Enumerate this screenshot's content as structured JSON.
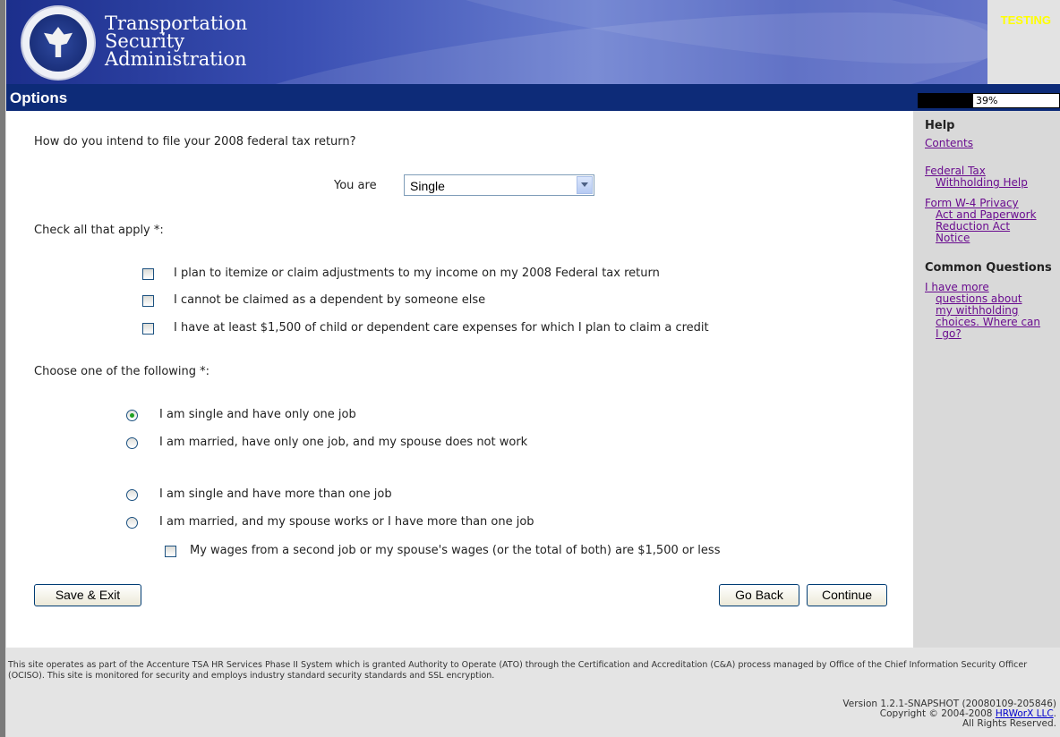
{
  "header": {
    "org_line1": "Transportation",
    "org_line2": "Security",
    "org_line3": "Administration",
    "testing_label": "TESTING"
  },
  "title_bar": {
    "title": "Options",
    "progress_text": "39%",
    "progress_value": 0.39
  },
  "form": {
    "question": "How do you intend to file your 2008 federal tax return?",
    "you_are_label": "You are",
    "filing_status": {
      "selected": "Single"
    },
    "check_all_label": "Check all that apply *:",
    "checkboxes": [
      {
        "label": "I plan to itemize or claim adjustments to my income on my 2008 Federal tax return",
        "checked": false
      },
      {
        "label": "I cannot be claimed as a dependent by someone else",
        "checked": false
      },
      {
        "label": "I have at least $1,500 of child or dependent care expenses for which I plan to claim a credit",
        "checked": false
      }
    ],
    "choose_label": "Choose one of the following *:",
    "radios": [
      {
        "label": "I am single and have only one job",
        "checked": true
      },
      {
        "label": "I am married, have only one job, and my spouse does not work",
        "checked": false
      },
      {
        "label": "I am single and have more than one job",
        "checked": false
      },
      {
        "label": "I am married, and my spouse works or I have more than one job",
        "checked": false
      }
    ],
    "sub_checkbox": {
      "label": "My wages from a second job or my spouse's wages (or the total of both) are $1,500 or less",
      "checked": false
    },
    "buttons": {
      "save_exit": "Save & Exit",
      "go_back": "Go Back",
      "continue": "Continue"
    }
  },
  "sidebar": {
    "help_heading": "Help",
    "contents_link": "Contents",
    "fed_tax_line1": "Federal Tax",
    "fed_tax_line2": "Withholding Help",
    "w4_line1": "Form W-4 Privacy",
    "w4_line2": "Act and Paperwork",
    "w4_line3": "Reduction Act",
    "w4_line4": "Notice",
    "common_heading": "Common Questions",
    "cq_line1": "I have more",
    "cq_line2": "questions about",
    "cq_line3": "my withholding",
    "cq_line4": "choices. Where can",
    "cq_line5": "I go?"
  },
  "footer": {
    "notice": "This site operates as part of the Accenture TSA HR Services Phase II System which is granted Authority to Operate (ATO) through the Certification and Accreditation (C&A) process managed by Office of the Chief Information Security Officer (OCISO). This site is monitored for security and employs industry standard security standards and SSL encryption.",
    "version": "Version 1.2.1-SNAPSHOT (20080109-205846)",
    "copyright_prefix": "Copyright © 2004-2008 ",
    "copyright_link": "HRWorX LLC",
    "copyright_suffix": ".",
    "rights": "All Rights Reserved."
  },
  "colors": {
    "title_bar": "#0d2b78",
    "sidebar_bg": "#d9d9d9",
    "link_visited": "#6a0c8f",
    "testing": "#ffff00"
  }
}
